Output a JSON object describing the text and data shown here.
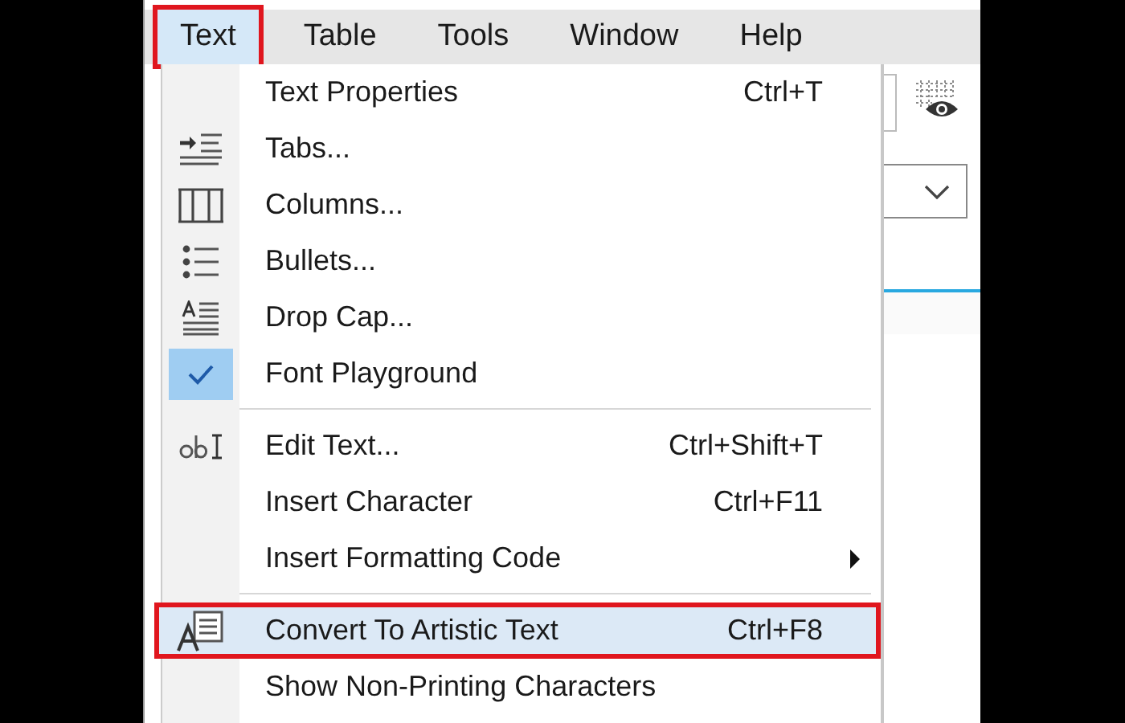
{
  "menu_bar": [
    {
      "label": "Text",
      "selected": true,
      "highlighted": true
    },
    {
      "label": "Table",
      "selected": false,
      "highlighted": false
    },
    {
      "label": "Tools",
      "selected": false,
      "highlighted": false
    },
    {
      "label": "Window",
      "selected": false,
      "highlighted": false
    },
    {
      "label": "Help",
      "selected": false,
      "highlighted": false
    }
  ],
  "menu": [
    {
      "kind": "item",
      "label": "Text Properties",
      "shortcut": "Ctrl+T",
      "checked": false,
      "highlighted": false,
      "submenu": false
    },
    {
      "kind": "item",
      "label": "Tabs...",
      "checked": false,
      "highlighted": false,
      "submenu": false
    },
    {
      "kind": "item",
      "label": "Columns...",
      "checked": false,
      "highlighted": false,
      "submenu": false
    },
    {
      "kind": "item",
      "label": "Bullets...",
      "checked": false,
      "highlighted": false,
      "submenu": false
    },
    {
      "kind": "item",
      "label": "Drop Cap...",
      "checked": false,
      "highlighted": false,
      "submenu": false
    },
    {
      "kind": "item",
      "label": "Font Playground",
      "checked": true,
      "highlighted": false,
      "submenu": false
    },
    {
      "kind": "separator"
    },
    {
      "kind": "item",
      "label": "Edit Text...",
      "shortcut": "Ctrl+Shift+T",
      "checked": false,
      "highlighted": false,
      "submenu": false
    },
    {
      "kind": "item",
      "label": "Insert Character",
      "shortcut": "Ctrl+F11",
      "checked": false,
      "highlighted": false,
      "submenu": false
    },
    {
      "kind": "item",
      "label": "Insert Formatting Code",
      "checked": false,
      "highlighted": false,
      "submenu": true
    },
    {
      "kind": "separator"
    },
    {
      "kind": "item",
      "label": "Convert To Artistic Text",
      "shortcut": "Ctrl+F8",
      "checked": false,
      "highlighted": true,
      "submenu": false
    },
    {
      "kind": "item",
      "label": "Show Non-Printing Characters",
      "checked": false,
      "highlighted": false,
      "submenu": false
    }
  ]
}
